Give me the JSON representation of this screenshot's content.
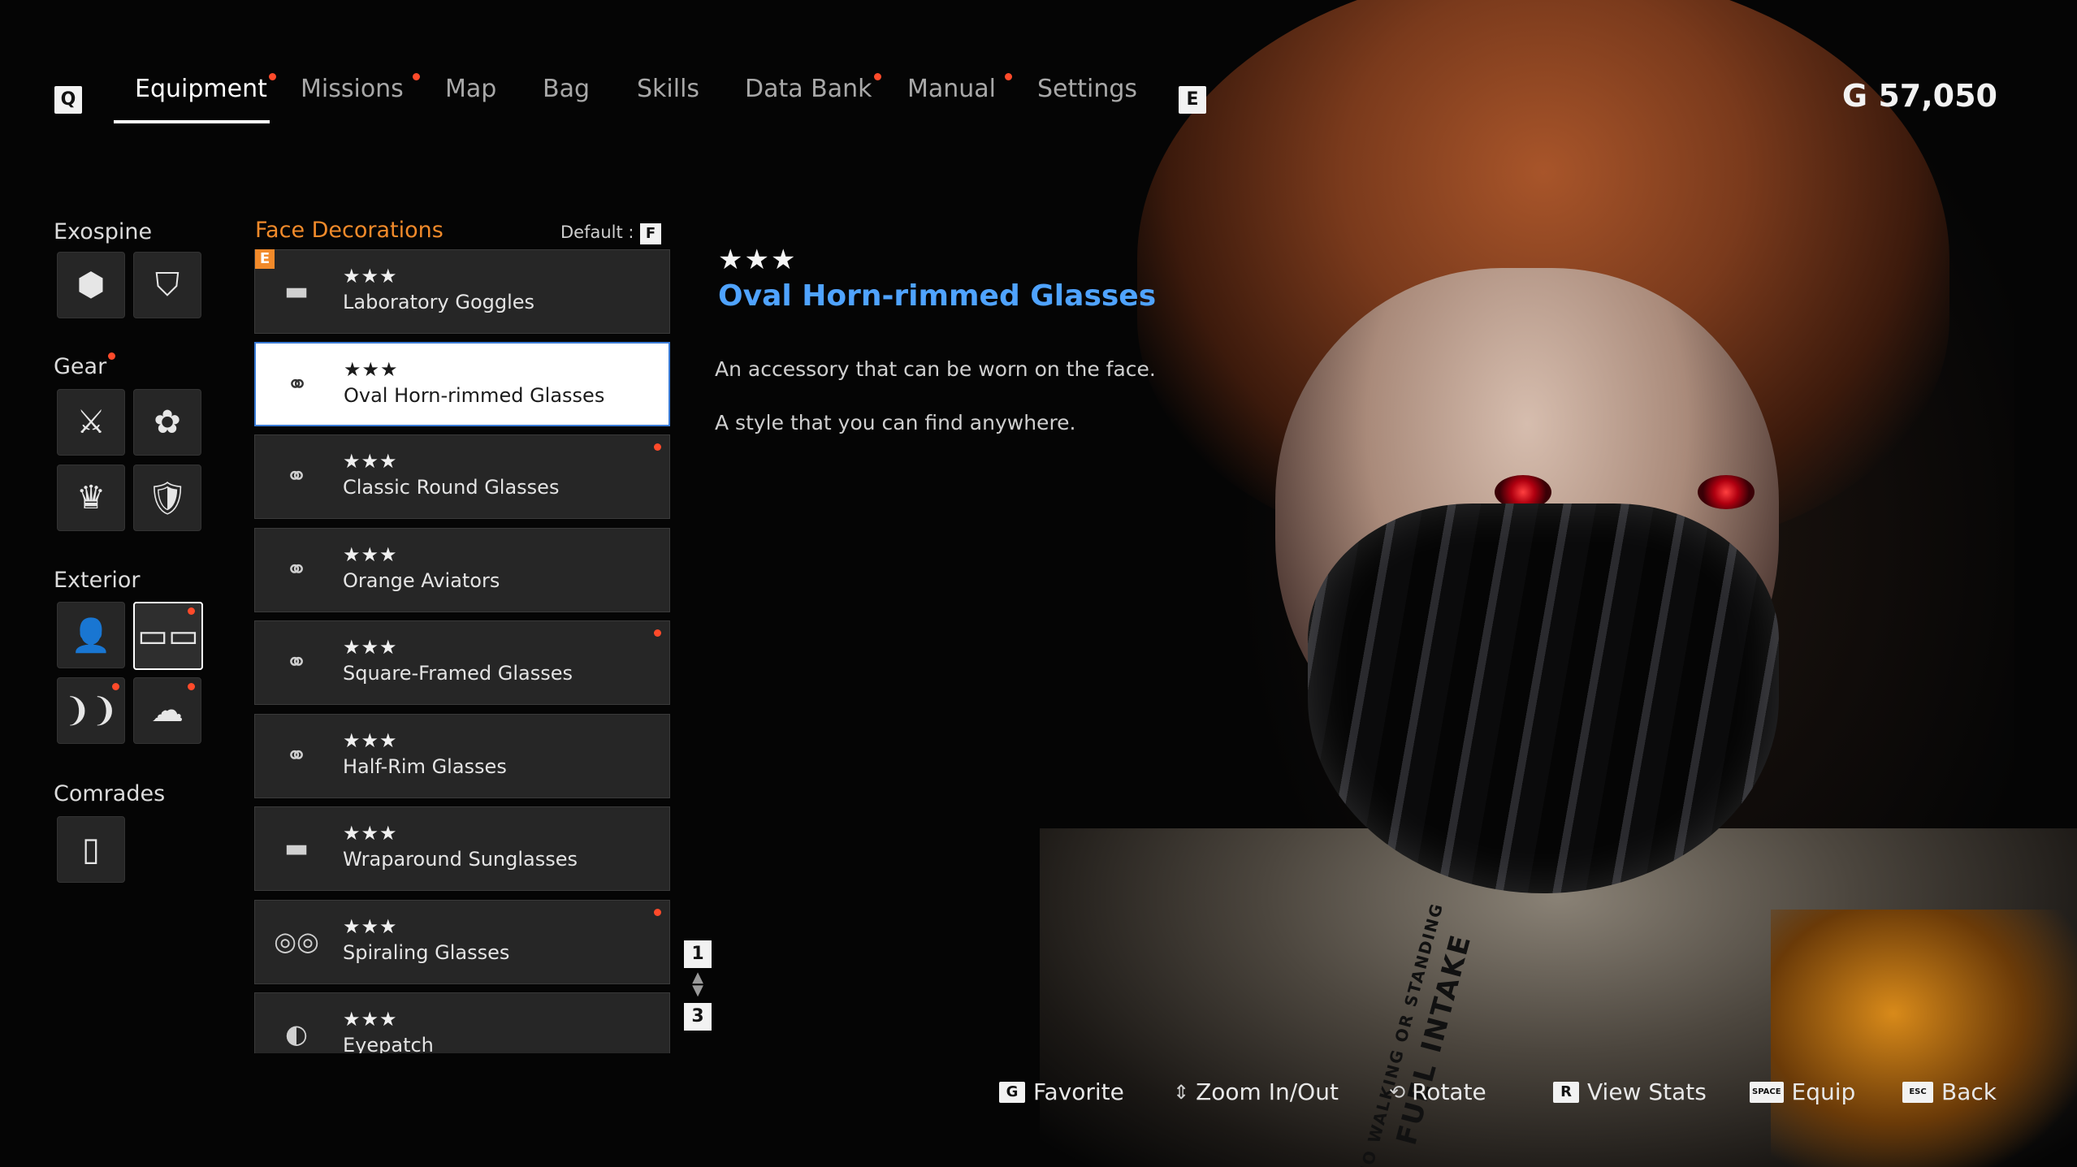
{
  "nav": {
    "left_key": "Q",
    "right_key": "E",
    "tabs": [
      {
        "label": "Equipment",
        "active": true,
        "dot": true
      },
      {
        "label": "Missions",
        "active": false,
        "dot": true
      },
      {
        "label": "Map",
        "active": false,
        "dot": false
      },
      {
        "label": "Bag",
        "active": false,
        "dot": false
      },
      {
        "label": "Skills",
        "active": false,
        "dot": false
      },
      {
        "label": "Data Bank",
        "active": false,
        "dot": true
      },
      {
        "label": "Manual",
        "active": false,
        "dot": true
      },
      {
        "label": "Settings",
        "active": false,
        "dot": false
      }
    ]
  },
  "currency": {
    "symbol": "G",
    "amount": "57,050"
  },
  "categories": {
    "exospine": "Exospine",
    "gear": "Gear",
    "exterior": "Exterior",
    "comrades": "Comrades"
  },
  "list": {
    "title": "Face Decorations",
    "default_label": "Default :",
    "default_key": "F",
    "equipped_badge": "E",
    "items": [
      {
        "stars": "★★★",
        "name": "Laboratory Goggles",
        "icon": "goggles-icon",
        "selected": false,
        "dot": false
      },
      {
        "stars": "★★★",
        "name": "Oval Horn-rimmed Glasses",
        "icon": "glasses-icon",
        "selected": true,
        "dot": false
      },
      {
        "stars": "★★★",
        "name": "Classic Round Glasses",
        "icon": "glasses-icon",
        "selected": false,
        "dot": true
      },
      {
        "stars": "★★★",
        "name": "Orange Aviators",
        "icon": "aviators-icon",
        "selected": false,
        "dot": false
      },
      {
        "stars": "★★★",
        "name": "Square-Framed Glasses",
        "icon": "glasses-icon",
        "selected": false,
        "dot": true
      },
      {
        "stars": "★★★",
        "name": "Half-Rim Glasses",
        "icon": "glasses-icon",
        "selected": false,
        "dot": false
      },
      {
        "stars": "★★★",
        "name": "Wraparound Sunglasses",
        "icon": "sunglasses-icon",
        "selected": false,
        "dot": false
      },
      {
        "stars": "★★★",
        "name": "Spiraling Glasses",
        "icon": "spiral-glasses-icon",
        "selected": false,
        "dot": true
      },
      {
        "stars": "★★★",
        "name": "Eyepatch",
        "icon": "eyepatch-icon",
        "selected": false,
        "dot": false
      }
    ],
    "page_up_key": "1",
    "page_down_key": "3"
  },
  "detail": {
    "stars": "★★★",
    "title": "Oval Horn-rimmed Glasses",
    "desc1": "An accessory that can be worn on the face.",
    "desc2": "A style that you can find anywhere."
  },
  "hints": [
    {
      "key": "G",
      "label": "Favorite"
    },
    {
      "key": "",
      "label": "Zoom In/Out"
    },
    {
      "key": "",
      "label": "Rotate"
    },
    {
      "key": "R",
      "label": "View Stats"
    },
    {
      "key": "SPACE",
      "label": "Equip"
    },
    {
      "key": "ESC",
      "label": "Back"
    }
  ],
  "suit": {
    "line1": "FUEL INTAKE",
    "line2": "NO WALKING OR STANDING"
  },
  "colors": {
    "accent_orange": "#f28a2a",
    "title_blue": "#4fa3ff",
    "notify_red": "#ff4a2a"
  }
}
